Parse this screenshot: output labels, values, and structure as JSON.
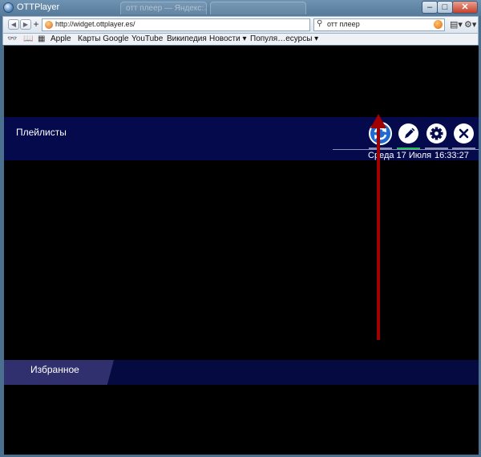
{
  "window": {
    "title": "OTTPlayer",
    "ghost_tab_1": "отт плеер — Яндекс:…",
    "ghost_tab_2": ""
  },
  "toolbar": {
    "url": "http://widget.ottplayer.es/",
    "search_query": "отт плеер"
  },
  "bookmarks": [
    "Apple",
    "Карты Google",
    "YouTube",
    "Википедия",
    "Новости",
    "Популя…есурсы"
  ],
  "app": {
    "playlists_title": "Плейлисты",
    "date": "Среда 17 Июля",
    "time": "16:33:27",
    "favorites_label": "Избранное"
  },
  "colors": {
    "band": "#040a4c",
    "refresh": "#1f6ad0",
    "active_underline": "#1fbf5a",
    "arrow": "#a00000"
  },
  "icons": [
    "refresh-icon",
    "pencil-icon",
    "gear-icon",
    "close-icon"
  ]
}
